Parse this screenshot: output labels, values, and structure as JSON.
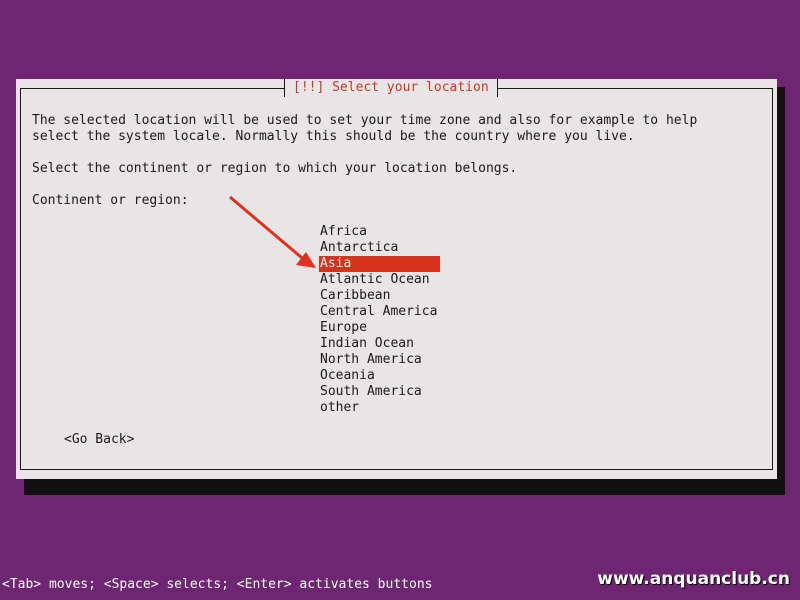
{
  "dialog": {
    "title": "[!!] Select your location",
    "description_line1": "The selected location will be used to set your time zone and also for example to help",
    "description_line2": "select the system locale. Normally this should be the country where you live.",
    "instruction": "Select the continent or region to which your location belongs.",
    "field_label": "Continent or region:",
    "options": [
      {
        "label": "Africa",
        "selected": false
      },
      {
        "label": "Antarctica",
        "selected": false
      },
      {
        "label": "Asia",
        "selected": true
      },
      {
        "label": "Atlantic Ocean",
        "selected": false
      },
      {
        "label": "Caribbean",
        "selected": false
      },
      {
        "label": "Central America",
        "selected": false
      },
      {
        "label": "Europe",
        "selected": false
      },
      {
        "label": "Indian Ocean",
        "selected": false
      },
      {
        "label": "North America",
        "selected": false
      },
      {
        "label": "Oceania",
        "selected": false
      },
      {
        "label": "South America",
        "selected": false
      },
      {
        "label": "other",
        "selected": false
      }
    ],
    "go_back_label": "<Go Back>"
  },
  "statusbar": {
    "help_text": "<Tab> moves; <Space> selects; <Enter> activates buttons"
  },
  "watermark": {
    "text": "www.anquanclub.cn"
  },
  "colors": {
    "background": "#6f2672",
    "dialog": "#e9e4e6",
    "title": "#c83a24",
    "selection": "#d8321c",
    "arrow": "#e0301e"
  }
}
